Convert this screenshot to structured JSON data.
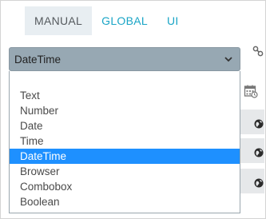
{
  "tabs": [
    {
      "label": "MANUAL",
      "active": true
    },
    {
      "label": "GLOBAL",
      "active": false
    },
    {
      "label": "UI",
      "active": false
    }
  ],
  "select": {
    "value": "DateTime",
    "icon": "chevron-down-icon"
  },
  "dropdown": {
    "options": [
      "Text",
      "Number",
      "Date",
      "Time",
      "DateTime",
      "Browser",
      "Combobox",
      "Boolean"
    ],
    "selected": "DateTime"
  },
  "side_icons": [
    "link-icon",
    "calendar-icon",
    "globe-icon"
  ],
  "colors": {
    "accent": "#1aa5c6",
    "select_bg": "#97a8b3",
    "highlight": "#1e90ff",
    "tab_active_bg": "#e8eef2"
  }
}
